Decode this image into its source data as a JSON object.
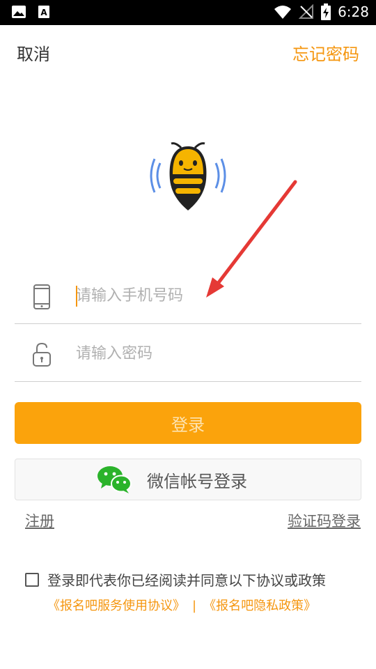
{
  "status_bar": {
    "time": "6:28",
    "icons": [
      "image-icon",
      "text-app-icon",
      "wifi-icon",
      "no-signal-icon",
      "battery-charging-icon"
    ]
  },
  "top_bar": {
    "cancel_label": "取消",
    "forgot_password_label": "忘记密码"
  },
  "logo": {
    "icon": "bee-logo-icon"
  },
  "form": {
    "phone": {
      "icon": "phone-icon",
      "placeholder": "请输入手机号码",
      "value": ""
    },
    "password": {
      "icon": "lock-icon",
      "placeholder": "请输入密码",
      "value": ""
    }
  },
  "login_button_label": "登录",
  "wechat_login": {
    "icon": "wechat-icon",
    "label": "微信帐号登录"
  },
  "links": {
    "register_label": "注册",
    "code_login_label": "验证码登录"
  },
  "agreement": {
    "checked": false,
    "text": "登录即代表你已经阅读并同意以下协议或政策",
    "service_agreement": "《报名吧服务使用协议》",
    "separator": "|",
    "privacy_policy": "《报名吧隐私政策》"
  },
  "colors": {
    "accent": "#f5960f",
    "login_button_bg": "#fba30c",
    "annotation_arrow": "#e53935",
    "wechat_green": "#2bb32b"
  }
}
